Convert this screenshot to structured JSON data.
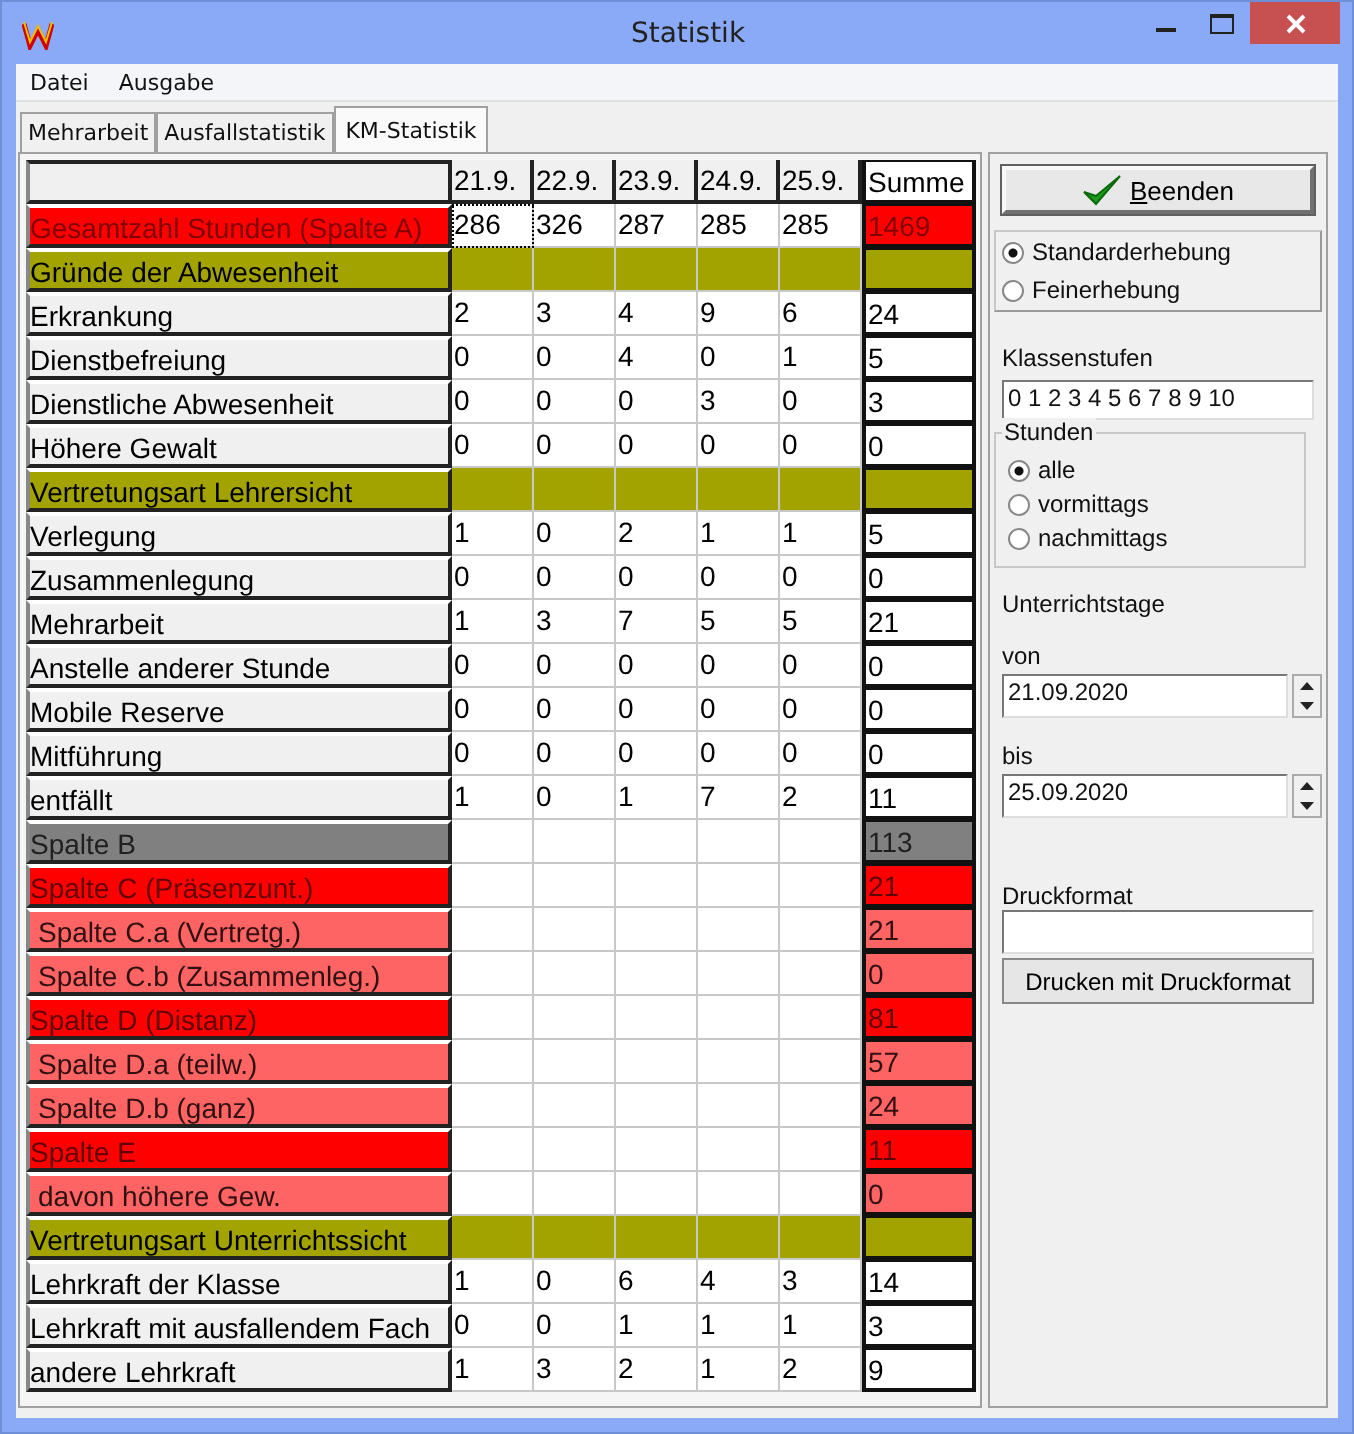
{
  "window": {
    "title": "Statistik"
  },
  "menu": [
    "Datei",
    "Ausgabe"
  ],
  "tabs": [
    {
      "label": "Mehrarbeit",
      "selected": false
    },
    {
      "label": "Ausfallstatistik",
      "selected": false
    },
    {
      "label": "KM-Statistik",
      "selected": true
    }
  ],
  "table": {
    "columns": [
      "21.9.",
      "22.9.",
      "23.9.",
      "24.9.",
      "25.9.",
      "Summe"
    ],
    "rows": [
      {
        "kind": "total",
        "label": "Gesamtzahl Stunden (Spalte A)",
        "values": [
          "286",
          "326",
          "287",
          "285",
          "285"
        ],
        "sum": "1469"
      },
      {
        "kind": "section",
        "label": "Gründe der Abwesenheit"
      },
      {
        "kind": "data",
        "label": "Erkrankung",
        "values": [
          "2",
          "3",
          "4",
          "9",
          "6"
        ],
        "sum": "24"
      },
      {
        "kind": "data",
        "label": "Dienstbefreiung",
        "values": [
          "0",
          "0",
          "4",
          "0",
          "1"
        ],
        "sum": "5"
      },
      {
        "kind": "data",
        "label": "Dienstliche Abwesenheit",
        "values": [
          "0",
          "0",
          "0",
          "3",
          "0"
        ],
        "sum": "3"
      },
      {
        "kind": "data",
        "label": "Höhere Gewalt",
        "values": [
          "0",
          "0",
          "0",
          "0",
          "0"
        ],
        "sum": "0"
      },
      {
        "kind": "section",
        "label": "Vertretungsart Lehrersicht"
      },
      {
        "kind": "data",
        "label": "Verlegung",
        "values": [
          "1",
          "0",
          "2",
          "1",
          "1"
        ],
        "sum": "5"
      },
      {
        "kind": "data",
        "label": "Zusammenlegung",
        "values": [
          "0",
          "0",
          "0",
          "0",
          "0"
        ],
        "sum": "0"
      },
      {
        "kind": "data",
        "label": "Mehrarbeit",
        "values": [
          "1",
          "3",
          "7",
          "5",
          "5"
        ],
        "sum": "21"
      },
      {
        "kind": "data",
        "label": "Anstelle anderer Stunde",
        "values": [
          "0",
          "0",
          "0",
          "0",
          "0"
        ],
        "sum": "0"
      },
      {
        "kind": "data",
        "label": "Mobile Reserve",
        "values": [
          "0",
          "0",
          "0",
          "0",
          "0"
        ],
        "sum": "0"
      },
      {
        "kind": "data",
        "label": "Mitführung",
        "values": [
          "0",
          "0",
          "0",
          "0",
          "0"
        ],
        "sum": "0"
      },
      {
        "kind": "data",
        "label": "entfällt",
        "values": [
          "1",
          "0",
          "1",
          "7",
          "2"
        ],
        "sum": "11"
      },
      {
        "kind": "grey",
        "label": "Spalte B",
        "sum": "113"
      },
      {
        "kind": "red",
        "label": "Spalte C (Präsenzunt.)",
        "sum": "21"
      },
      {
        "kind": "sub",
        "label": "Spalte C.a (Vertretg.)",
        "sum": "21"
      },
      {
        "kind": "sub",
        "label": "Spalte C.b (Zusammenleg.)",
        "sum": "0"
      },
      {
        "kind": "red",
        "label": "Spalte D (Distanz)",
        "sum": "81"
      },
      {
        "kind": "sub",
        "label": "Spalte D.a (teilw.)",
        "sum": "57"
      },
      {
        "kind": "sub",
        "label": "Spalte D.b (ganz)",
        "sum": "24"
      },
      {
        "kind": "red",
        "label": "Spalte E",
        "sum": "11"
      },
      {
        "kind": "sub",
        "label": "davon höhere Gew.",
        "sum": "0"
      },
      {
        "kind": "section",
        "label": "Vertretungsart Unterrichtssicht"
      },
      {
        "kind": "data",
        "label": "Lehrkraft der Klasse",
        "values": [
          "1",
          "0",
          "6",
          "4",
          "3"
        ],
        "sum": "14"
      },
      {
        "kind": "data",
        "label": "Lehrkraft mit ausfallendem Fach",
        "values": [
          "0",
          "0",
          "1",
          "1",
          "1"
        ],
        "sum": "3"
      },
      {
        "kind": "data",
        "label": "andere Lehrkraft",
        "values": [
          "1",
          "3",
          "2",
          "1",
          "2"
        ],
        "sum": "9"
      }
    ]
  },
  "panel": {
    "close_button": "Beenden",
    "mode_options": [
      {
        "label": "Standarderhebung",
        "selected": true
      },
      {
        "label": "Feinerhebung",
        "selected": false
      }
    ],
    "grades_label": "Klassenstufen",
    "grades_value": "0 1 2 3 4 5 6 7 8 9 10",
    "hours_group": {
      "title": "Stunden",
      "options": [
        {
          "label": "alle",
          "selected": true
        },
        {
          "label": "vormittags",
          "selected": false
        },
        {
          "label": "nachmittags",
          "selected": false
        }
      ]
    },
    "days_label": "Unterrichtstage",
    "from_label": "von",
    "from_value": "21.09.2020",
    "to_label": "bis",
    "to_value": "25.09.2020",
    "print_format_label": "Druckformat",
    "print_button": "Drucken mit Druckformat"
  }
}
